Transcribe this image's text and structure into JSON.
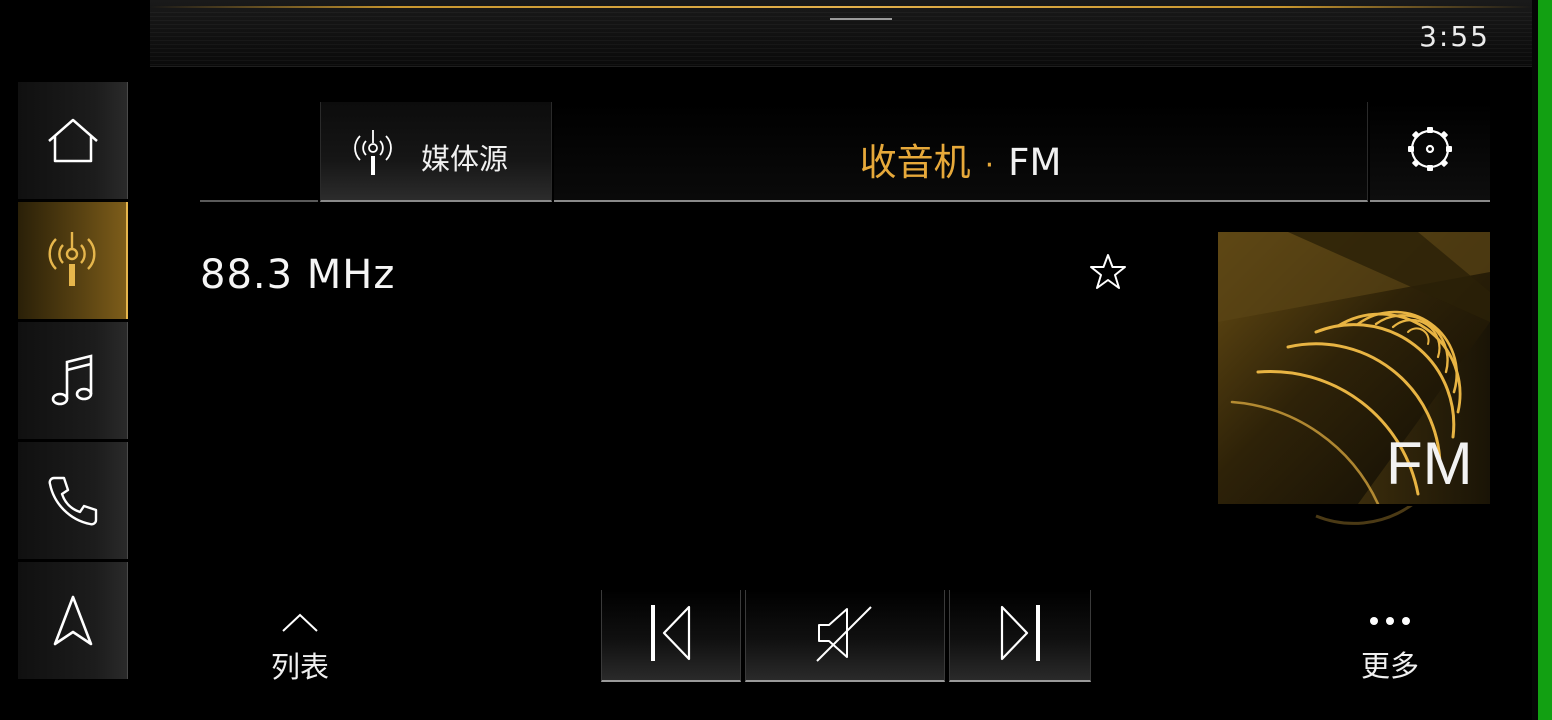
{
  "status_bar": {
    "time": "3:55"
  },
  "sidebar": {
    "items": [
      {
        "name": "home",
        "icon": "home-icon",
        "active": false
      },
      {
        "name": "radio",
        "icon": "radio-antenna-icon",
        "active": true
      },
      {
        "name": "music",
        "icon": "music-note-icon",
        "active": false
      },
      {
        "name": "phone",
        "icon": "phone-icon",
        "active": false
      },
      {
        "name": "navigation",
        "icon": "navigation-arrow-icon",
        "active": false
      }
    ]
  },
  "header": {
    "media_source_label": "媒体源",
    "media_source_icon": "antenna-icon",
    "title_main": "收音机",
    "title_separator": "·",
    "title_sub": "FM",
    "settings_icon": "gear-icon"
  },
  "station": {
    "frequency": "88.3 MHz",
    "favorite_icon": "star-outline-icon",
    "art_label": "FM"
  },
  "controls": {
    "list_label": "列表",
    "list_icon": "chevron-up-icon",
    "prev_icon": "skip-previous-icon",
    "mute_icon": "speaker-muted-icon",
    "next_icon": "skip-next-icon",
    "more_label": "更多",
    "more_icon": "more-dots-icon"
  },
  "colors": {
    "accent": "#e7a93a",
    "text": "#f0f0f0",
    "background": "#000000",
    "edge": "#12a012"
  }
}
